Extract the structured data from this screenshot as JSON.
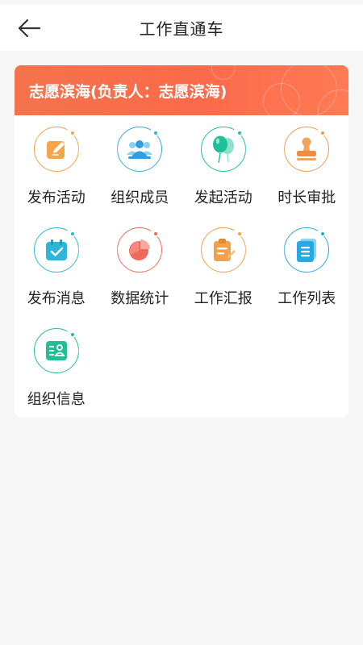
{
  "nav": {
    "title": "工作直通车",
    "back_icon": "back-arrow-icon"
  },
  "card": {
    "title": "志愿滨海(负责人：志愿滨海)",
    "header_color": "#f86f4e"
  },
  "items": [
    {
      "label": "发布活动",
      "icon": "edit-icon",
      "color": "#f4a14a"
    },
    {
      "label": "组织成员",
      "icon": "members-icon",
      "color": "#3aa7df"
    },
    {
      "label": "发起活动",
      "icon": "balloon-icon",
      "color": "#1fbf9a"
    },
    {
      "label": "时长审批",
      "icon": "stamp-icon",
      "color": "#f09a4d"
    },
    {
      "label": "发布消息",
      "icon": "calendar-check-icon",
      "color": "#2fb5d6"
    },
    {
      "label": "数据统计",
      "icon": "pie-chart-icon",
      "color": "#ef6a5b"
    },
    {
      "label": "工作汇报",
      "icon": "clipboard-edit-icon",
      "color": "#f3a04b"
    },
    {
      "label": "工作列表",
      "icon": "document-list-icon",
      "color": "#29a8df"
    },
    {
      "label": "组织信息",
      "icon": "id-card-icon",
      "color": "#22bf95"
    }
  ]
}
